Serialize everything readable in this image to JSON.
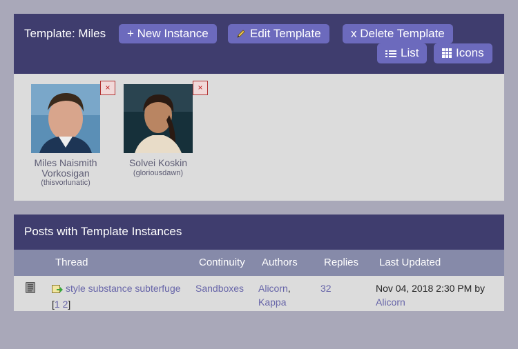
{
  "template": {
    "title": "Template: Miles",
    "buttons": {
      "new_instance": "+ New Instance",
      "edit_template": "Edit Template",
      "delete_template": "x Delete Template",
      "list": "List",
      "icons": "Icons"
    },
    "characters": [
      {
        "name": "Miles Naismith Vorkosigan",
        "screenname": "(thisvorlunatic)",
        "delete": "×"
      },
      {
        "name": "Solvei Koskin",
        "screenname": "(gloriousdawn)",
        "delete": "×"
      }
    ]
  },
  "posts": {
    "title": "Posts with Template Instances",
    "columns": {
      "thread": "Thread",
      "continuity": "Continuity",
      "authors": "Authors",
      "replies": "Replies",
      "last_updated": "Last Updated"
    },
    "rows": [
      {
        "thread": "style substance subterfuge",
        "page_open": "[",
        "page_1": "1",
        "page_2": "2",
        "page_close": "]",
        "continuity": "Sandboxes",
        "author_1": "Alicorn",
        "author_sep": ",",
        "author_2": "Kappa",
        "replies": "32",
        "last_updated": "Nov 04, 2018 2:30 PM by",
        "last_author": "Alicorn"
      }
    ]
  },
  "colors": {
    "header": "#3f3d6e",
    "button": "#6c6abd",
    "panel": "#dcdcdc",
    "column_bar": "#868aa9",
    "link": "#6664a8"
  }
}
